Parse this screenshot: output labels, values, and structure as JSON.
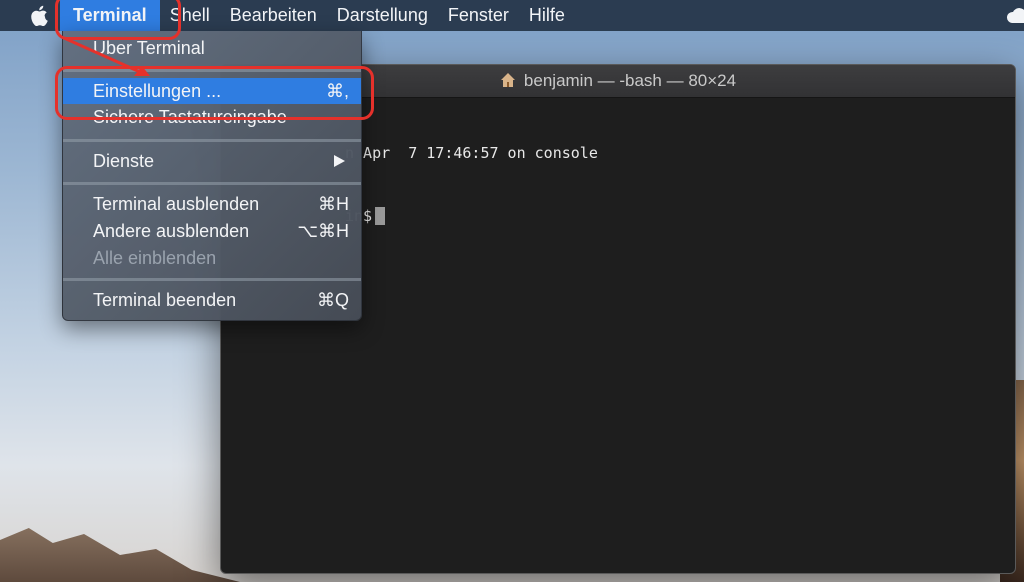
{
  "menubar": {
    "apple_icon": "apple-logo-icon",
    "items": [
      {
        "label": "Terminal",
        "active": true
      },
      {
        "label": "Shell"
      },
      {
        "label": "Bearbeiten"
      },
      {
        "label": "Darstellung"
      },
      {
        "label": "Fenster"
      },
      {
        "label": "Hilfe"
      }
    ],
    "status_icon": "creative-cloud-icon"
  },
  "terminal_menu": {
    "items": [
      {
        "label": "Über Terminal",
        "shortcut": ""
      },
      {
        "label": "Einstellungen ...",
        "shortcut": "⌘,",
        "highlighted": true
      },
      {
        "label": "Sichere Tastatureingabe",
        "shortcut": ""
      },
      {
        "label": "Dienste",
        "submenu": true
      },
      {
        "label": "Terminal ausblenden",
        "shortcut": "⌘H"
      },
      {
        "label": "Andere ausblenden",
        "shortcut": "⌥⌘H"
      },
      {
        "label": "Alle einblenden",
        "shortcut": "",
        "disabled": true
      },
      {
        "label": "Terminal beenden",
        "shortcut": "⌘Q"
      }
    ]
  },
  "terminal_window": {
    "title": "benjamin — -bash — 80×24",
    "title_icon": "home-icon",
    "lines": [
      "n Apr  7 17:46:57 on console",
      "in$"
    ]
  },
  "colors": {
    "menubar_bg": "#2b3c51",
    "highlight": "#2f7de1",
    "annotation": "#e5312b",
    "terminal_bg": "#1e1e1e"
  }
}
